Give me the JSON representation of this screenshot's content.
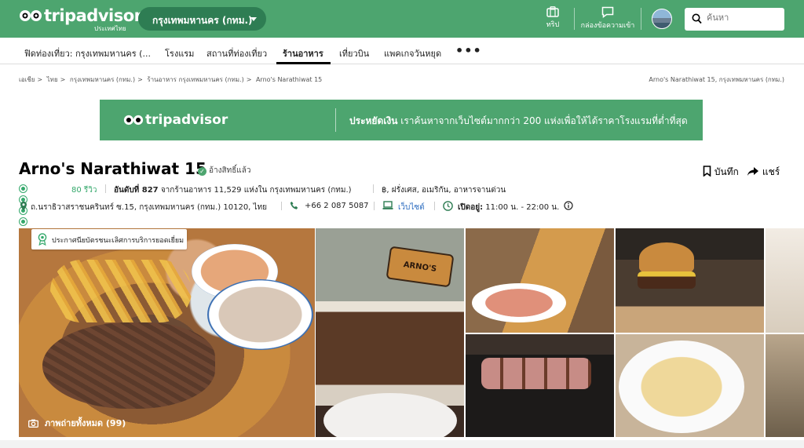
{
  "header": {
    "logo_text": "tripadvisor",
    "logo_country": "ประเทศไทย",
    "geo_selector": "กรุงเทพมหานคร (กทม.)",
    "trips_label": "ทริป",
    "inbox_label": "กล่องข้อความเข้า",
    "search_placeholder": "ค้นหา"
  },
  "nav": {
    "items": [
      {
        "label": "ฟิดท่องเที่ยว: กรุงเทพมหานคร (..."
      },
      {
        "label": "โรงแรม"
      },
      {
        "label": "สถานที่ท่องเที่ยว"
      },
      {
        "label": "ร้านอาหาร"
      },
      {
        "label": "เที่ยวบิน"
      },
      {
        "label": "แพคเกจวันหยุด"
      }
    ],
    "more": "•••"
  },
  "breadcrumb": {
    "items": [
      "เอเชีย",
      "ไทย",
      "กรุงเทพมหานคร (กทม.)",
      "ร้านอาหาร กรุงเทพมหานคร (กทม.)",
      "Arno's Narathiwat 15"
    ],
    "separator": ">",
    "right": "Arno's Narathiwat 15, กรุงเทพมหานคร (กทม.)"
  },
  "banner": {
    "logo": "tripadvisor",
    "bold": "ประหยัดเงิน",
    "text": " เราค้นหาจากเว็บไซต์มากกว่า 200 แห่งเพื่อให้ได้ราคาโรงแรมที่ต่ำที่สุด"
  },
  "restaurant": {
    "name": "Arno's Narathiwat 15",
    "verified": "อ้างสิทธิ์แล้ว",
    "save": "บันทึก",
    "share": "แชร์",
    "rating": 4.5,
    "reviews": "80 รีวิว",
    "rank_bold": "อันดับที่ 827",
    "rank_rest": " จากร้านอาหาร 11,529 แห่งใน กรุงเทพมหานคร (กทม.)",
    "cuisine": "฿, ฝรั่งเศส, อเมริกัน, อาหารจานด่วน",
    "address": "ถ.นราธิวาสราชนครินทร์ ซ.15, กรุงเทพมหานคร (กทม.) 10120, ไทย",
    "phone": "+66 2 087 5087",
    "website": "เว็บไซต์",
    "hours_bold": "เปิดอยู่:",
    "hours": " 11:00 น. - 22:00 น."
  },
  "photos": {
    "badge": "ประกาศนียบัตรชนะเลิศการบริการยอดเยี่ยม",
    "all_photos": "ภาพถ่ายทั้งหมด (99)",
    "sign_text": "ARNO'S"
  },
  "colors": {
    "brand_green": "#4da56f",
    "pill_green": "#2e7d53",
    "bubble_green": "#34a86b",
    "link_blue": "#2a6bbf"
  }
}
